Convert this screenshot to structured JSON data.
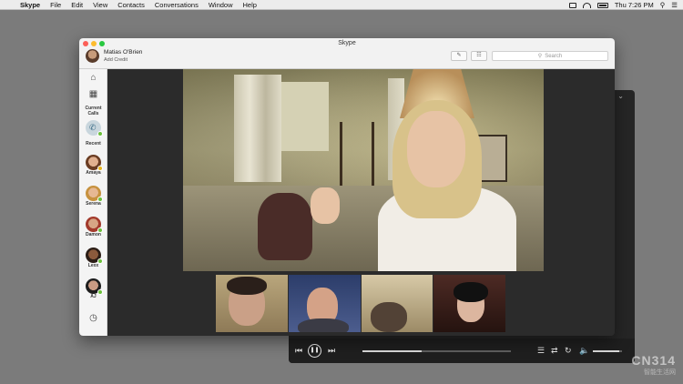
{
  "menubar": {
    "apple": "",
    "items": [
      "Skype",
      "File",
      "Edit",
      "View",
      "Contacts",
      "Conversations",
      "Window",
      "Help"
    ],
    "clock": "Thu 7:26 PM"
  },
  "window": {
    "title": "Skype",
    "profile": {
      "name": "Matias O'Brien",
      "credit": "Add Credit"
    },
    "search_placeholder": "Search"
  },
  "sidebar": {
    "current_calls_label": "Current Calls",
    "recent_label": "Recent",
    "contacts": [
      "Amaya",
      "Serena",
      "Damon",
      "Lexx",
      "AJ"
    ]
  },
  "player": {
    "progress_fraction": 0.4,
    "volume_fraction": 0.9
  },
  "watermark": {
    "brand": "CN314",
    "sub": "智能生活网"
  },
  "colors": {
    "presence": "#6bbf3a",
    "skype_accent": "#00aff0"
  },
  "icons": [
    "home-icon",
    "contacts-book-icon",
    "phone-icon",
    "clock-icon",
    "compose-icon",
    "dialpad-icon",
    "search-icon"
  ]
}
